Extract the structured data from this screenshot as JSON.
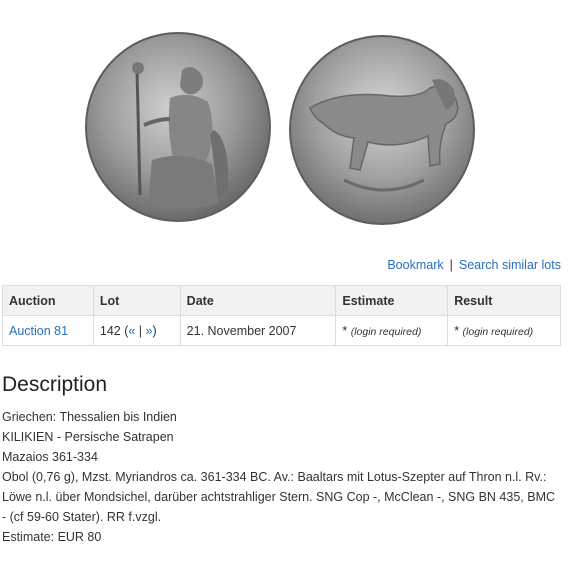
{
  "actions": {
    "bookmark": "Bookmark",
    "separator": "|",
    "similar": "Search similar lots"
  },
  "table": {
    "headers": [
      "Auction",
      "Lot",
      "Date",
      "Estimate",
      "Result"
    ],
    "row": {
      "auction": "Auction 81",
      "lot_number": "142 (",
      "prev": "«",
      "lot_sep": " | ",
      "next": "»",
      "lot_close": ")",
      "date": "21. November 2007",
      "estimate_star": "* ",
      "estimate_note": "(login required)",
      "result_star": "* ",
      "result_note": "(login required)"
    }
  },
  "description": {
    "heading": "Description",
    "lines": [
      "Griechen: Thessalien bis Indien",
      "KILIKIEN - Persische Satrapen",
      "Mazaios 361-334",
      "Obol (0,76 g), Mzst. Myriandros ca. 361-334 BC. Av.: Baaltars mit Lotus-Szepter auf Thron n.l. Rv.: Löwe n.l. über Mondsichel, darüber achtstrahliger Stern. SNG Cop -, McClean -, SNG BN 435, BMC - (cf 59-60 Stater). RR f.vzgl.",
      "Estimate: EUR 80"
    ]
  },
  "colors": {
    "link": "#2a6ebb",
    "header_bg": "#f2f2f2",
    "border": "#dddddd"
  }
}
